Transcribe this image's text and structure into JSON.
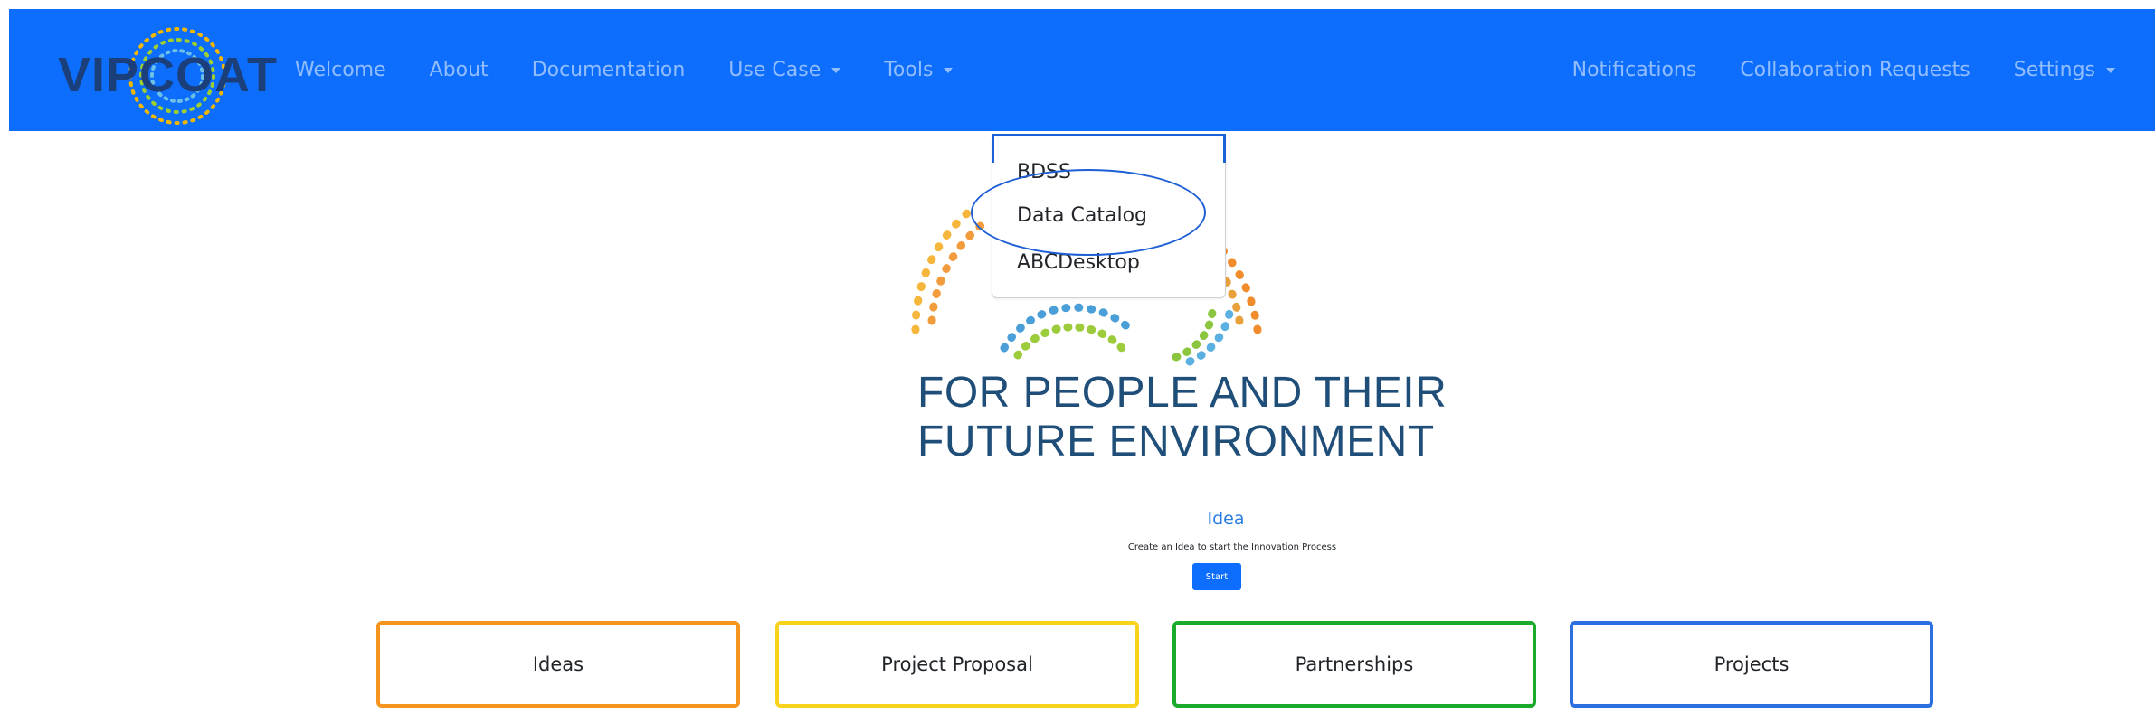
{
  "brand": {
    "name": "VIPCOAT"
  },
  "nav": {
    "left": [
      {
        "label": "Welcome"
      },
      {
        "label": "About"
      },
      {
        "label": "Documentation"
      },
      {
        "label": "Use Case"
      },
      {
        "label": "Tools"
      }
    ],
    "right": [
      {
        "label": "Notifications"
      },
      {
        "label": "Collaboration Requests"
      },
      {
        "label": "Settings"
      }
    ]
  },
  "tools_menu": {
    "items": [
      {
        "label": "BDSS"
      },
      {
        "label": "Data Catalog"
      },
      {
        "label": "ABCDesktop"
      }
    ]
  },
  "hero": {
    "line1": "FOR PEOPLE AND THEIR",
    "line2": "FUTURE ENVIRONMENT"
  },
  "idea": {
    "title": "Idea",
    "description": "Create an Idea to start the Innovation Process",
    "button": "Start"
  },
  "cards": [
    {
      "label": "Ideas",
      "color": "#f7941d"
    },
    {
      "label": "Project Proposal",
      "color": "#f9d21b"
    },
    {
      "label": "Partnerships",
      "color": "#1aab2c"
    },
    {
      "label": "Projects",
      "color": "#2b6fe0"
    }
  ],
  "colors": {
    "navbar": "#0d6efd",
    "highlight": "#1f5fd6"
  }
}
